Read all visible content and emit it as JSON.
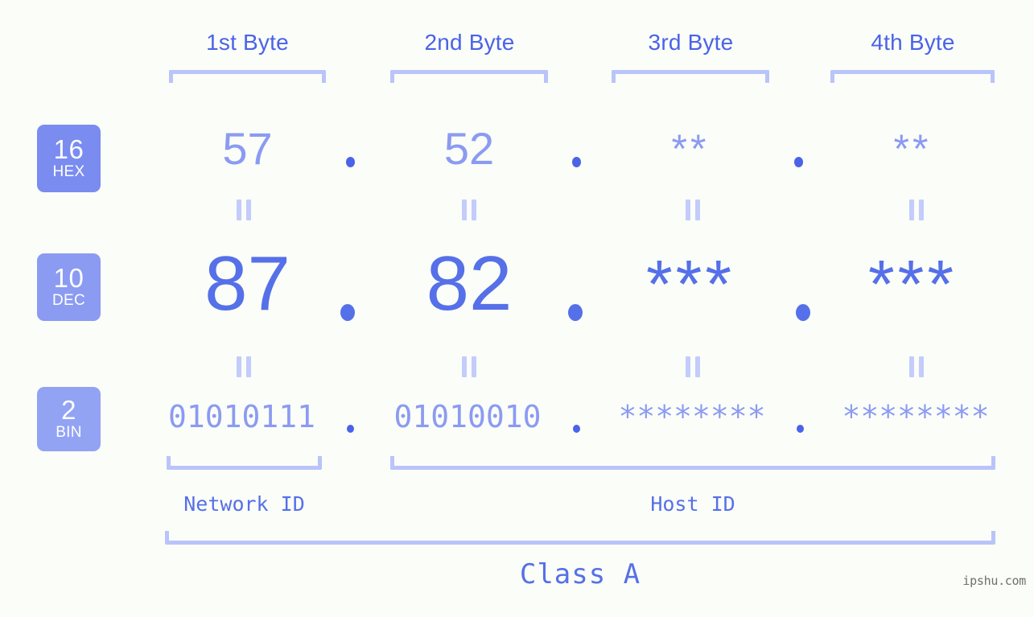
{
  "meta": {
    "background_color": "#fbfdf8",
    "accent_strong": "#4a63e8",
    "accent_mid": "#5570e8",
    "accent_light": "#8b9bf2",
    "accent_bracket": "#b9c4fa",
    "watermark_color": "#6f6f6f"
  },
  "headers": {
    "byte1": "1st Byte",
    "byte2": "2nd Byte",
    "byte3": "3rd Byte",
    "byte4": "4th Byte"
  },
  "radix_badges": [
    {
      "number": "16",
      "word": "HEX",
      "color": "#7a8cf0"
    },
    {
      "number": "10",
      "word": "DEC",
      "color": "#8b9bf2"
    },
    {
      "number": "2",
      "word": "BIN",
      "color": "#92a3f4"
    }
  ],
  "rows": {
    "hex": {
      "badge_number": "16",
      "badge_word": "HEX",
      "values": [
        "57",
        "52",
        "**",
        "**"
      ],
      "separators": [
        ".",
        ".",
        "."
      ]
    },
    "dec": {
      "badge_number": "10",
      "badge_word": "DEC",
      "values": [
        "87",
        "82",
        "***",
        "***"
      ],
      "separators": [
        ".",
        ".",
        "."
      ]
    },
    "bin": {
      "badge_number": "2",
      "badge_word": "BIN",
      "values": [
        "01010111",
        "01010010",
        "********",
        "********"
      ],
      "separators": [
        ".",
        ".",
        "."
      ]
    }
  },
  "equal_marks": {
    "glyph": "||",
    "count_per_row": 4
  },
  "sections": {
    "network_id": "Network ID",
    "host_id": "Host ID",
    "class": "Class A"
  },
  "watermark": "ipshu.com"
}
